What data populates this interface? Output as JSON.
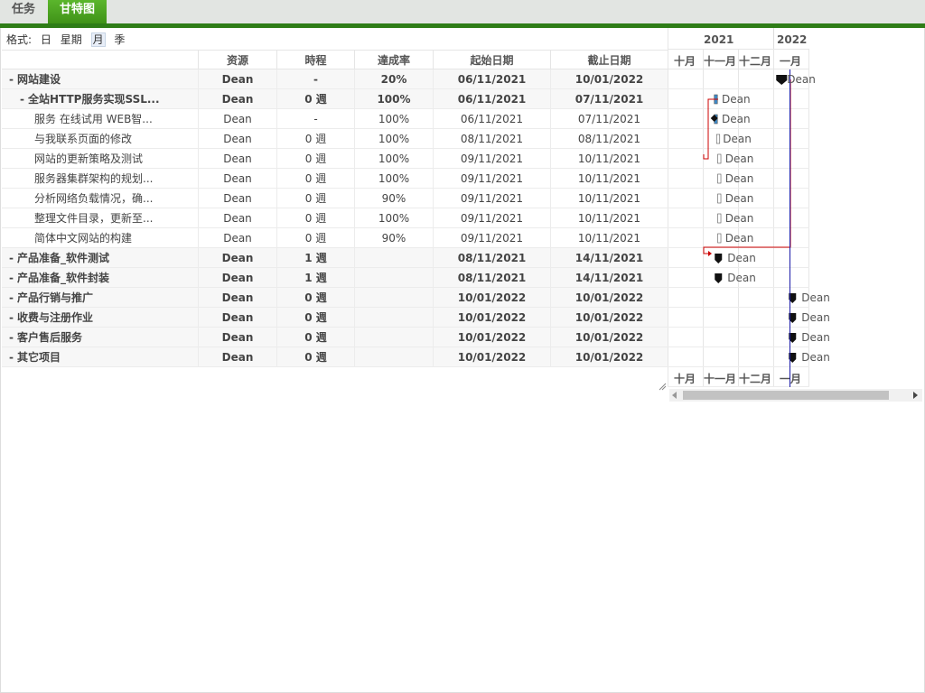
{
  "tabs": [
    {
      "label": "任务",
      "active": false
    },
    {
      "label": "甘特图",
      "active": true
    }
  ],
  "format": {
    "label": "格式:",
    "options": [
      "日",
      "星期",
      "月",
      "季"
    ],
    "selected": "月"
  },
  "columns": {
    "resource": "资源",
    "duration": "時程",
    "progress": "達成率",
    "start": "起始日期",
    "end": "截止日期"
  },
  "rows": [
    {
      "name": "网站建设",
      "prefix": "-",
      "level": 0,
      "bold": true,
      "resource": "Dean",
      "duration": "-",
      "progress": "20%",
      "start": "06/11/2021",
      "end": "10/01/2022"
    },
    {
      "name": "全站HTTP服务实现SSL...",
      "prefix": "-",
      "level": 1,
      "bold": true,
      "resource": "Dean",
      "duration": "0 週",
      "progress": "100%",
      "start": "06/11/2021",
      "end": "07/11/2021"
    },
    {
      "name": "服务  在线试用  WEB智...",
      "prefix": "",
      "level": 2,
      "bold": false,
      "resource": "Dean",
      "duration": "-",
      "progress": "100%",
      "start": "06/11/2021",
      "end": "07/11/2021"
    },
    {
      "name": "与我联系页面的修改",
      "prefix": "",
      "level": 2,
      "bold": false,
      "resource": "Dean",
      "duration": "0 週",
      "progress": "100%",
      "start": "08/11/2021",
      "end": "08/11/2021"
    },
    {
      "name": "网站的更新策略及测试",
      "prefix": "",
      "level": 2,
      "bold": false,
      "resource": "Dean",
      "duration": "0 週",
      "progress": "100%",
      "start": "09/11/2021",
      "end": "10/11/2021"
    },
    {
      "name": "服务器集群架构的规划...",
      "prefix": "",
      "level": 2,
      "bold": false,
      "resource": "Dean",
      "duration": "0 週",
      "progress": "100%",
      "start": "09/11/2021",
      "end": "10/11/2021"
    },
    {
      "name": "分析网络负载情况，确...",
      "prefix": "",
      "level": 2,
      "bold": false,
      "resource": "Dean",
      "duration": "0 週",
      "progress": "90%",
      "start": "09/11/2021",
      "end": "10/11/2021"
    },
    {
      "name": "整理文件目录，更新至...",
      "prefix": "",
      "level": 2,
      "bold": false,
      "resource": "Dean",
      "duration": "0 週",
      "progress": "100%",
      "start": "09/11/2021",
      "end": "10/11/2021"
    },
    {
      "name": "简体中文网站的构建",
      "prefix": "",
      "level": 2,
      "bold": false,
      "resource": "Dean",
      "duration": "0 週",
      "progress": "90%",
      "start": "09/11/2021",
      "end": "10/11/2021"
    },
    {
      "name": "产品准备_软件测试",
      "prefix": "-",
      "level": 0,
      "bold": true,
      "resource": "Dean",
      "duration": "1 週",
      "progress": "",
      "start": "08/11/2021",
      "end": "14/11/2021"
    },
    {
      "name": "产品准备_软件封装",
      "prefix": "-",
      "level": 0,
      "bold": true,
      "resource": "Dean",
      "duration": "1 週",
      "progress": "",
      "start": "08/11/2021",
      "end": "14/11/2021"
    },
    {
      "name": "产品行销与推广",
      "prefix": "-",
      "level": 0,
      "bold": true,
      "resource": "Dean",
      "duration": "0 週",
      "progress": "",
      "start": "10/01/2022",
      "end": "10/01/2022"
    },
    {
      "name": "收费与注册作业",
      "prefix": "-",
      "level": 0,
      "bold": true,
      "resource": "Dean",
      "duration": "0 週",
      "progress": "",
      "start": "10/01/2022",
      "end": "10/01/2022"
    },
    {
      "name": "客户售后服务",
      "prefix": "-",
      "level": 0,
      "bold": true,
      "resource": "Dean",
      "duration": "0 週",
      "progress": "",
      "start": "10/01/2022",
      "end": "10/01/2022"
    },
    {
      "name": "其它项目",
      "prefix": "-",
      "level": 0,
      "bold": true,
      "resource": "Dean",
      "duration": "0 週",
      "progress": "",
      "start": "10/01/2022",
      "end": "10/01/2022"
    }
  ],
  "gantt": {
    "years": [
      "2021",
      "2022"
    ],
    "months": [
      "十月",
      "十一月",
      "十二月",
      "一月"
    ],
    "bar_labels": [
      "Dean",
      "Dean",
      "Dean",
      "Dean",
      "Dean",
      "Dean",
      "Dean",
      "Dean",
      "Dean",
      "Dean",
      "Dean",
      "Dean",
      "Dean",
      "Dean",
      "Dean"
    ],
    "today_line_color": "#1a1aa8",
    "dependency_color": "#cc0000",
    "bar_color": "#3e8ac8",
    "milestone_color": "#111111"
  }
}
